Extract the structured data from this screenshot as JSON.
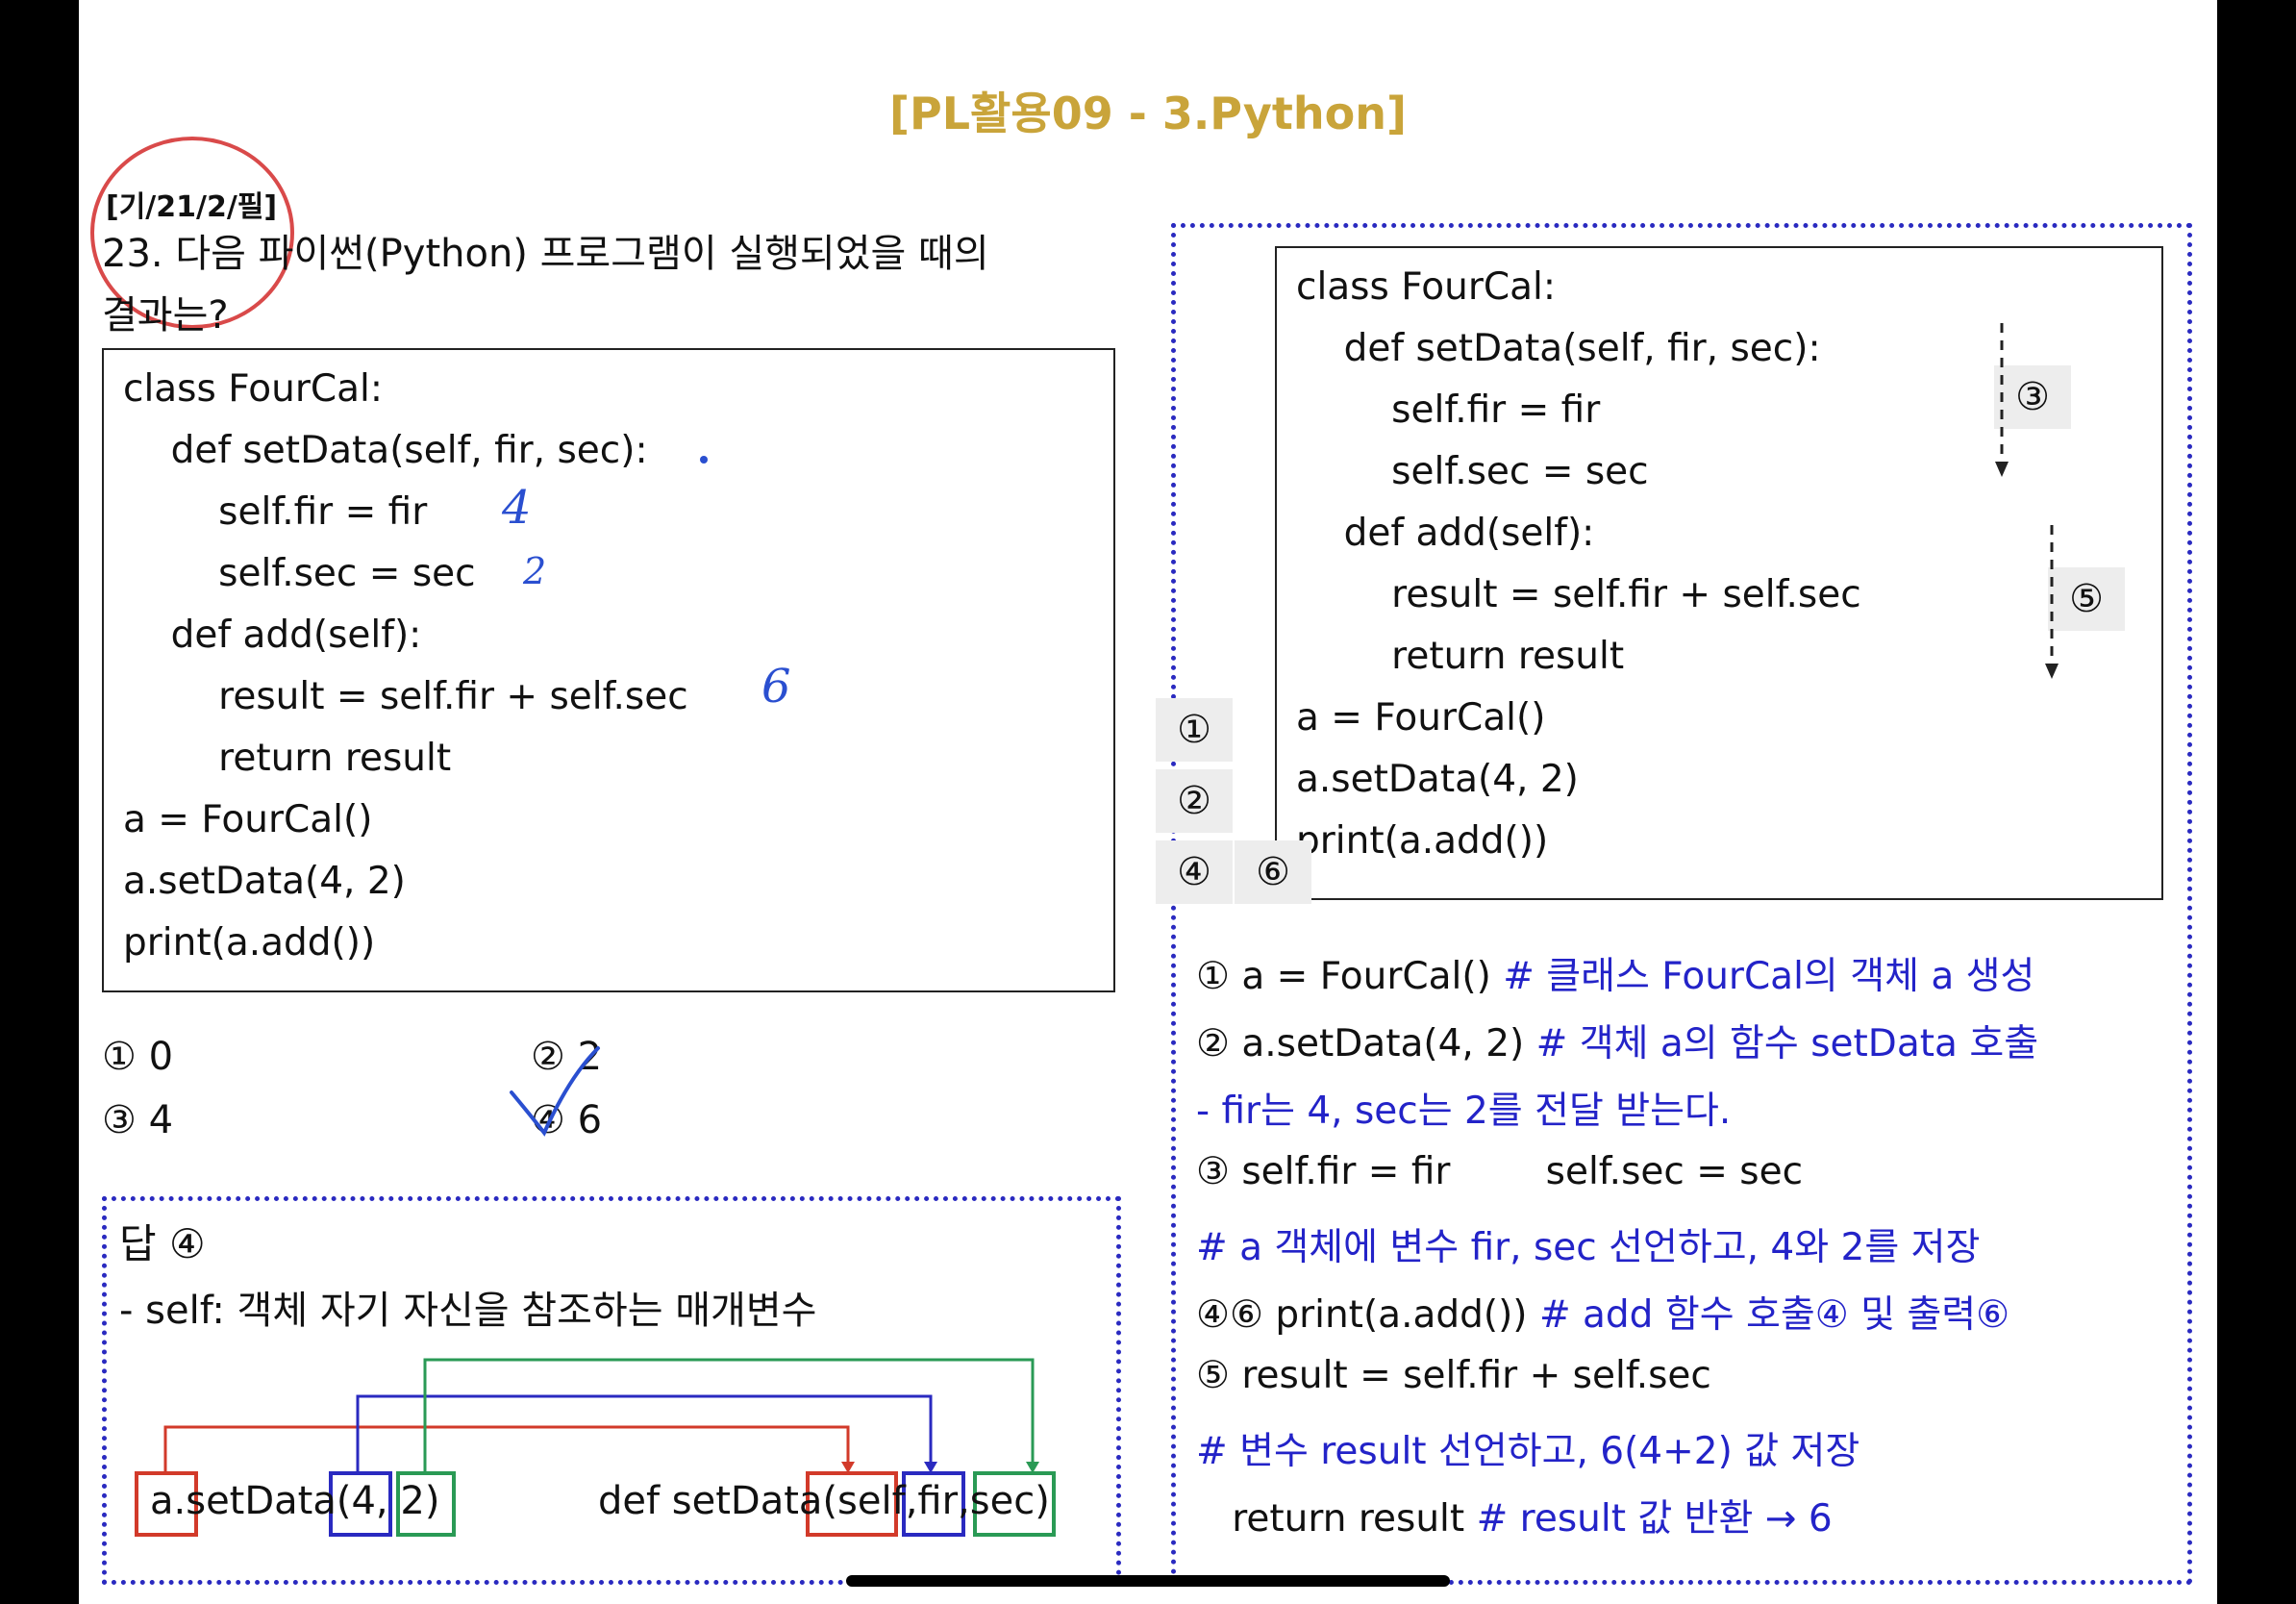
{
  "title": "[PL활용09 - 3.Python]",
  "question": {
    "tag": "[기/21/2/필]",
    "text_line1": "23. 다음 파이썬(Python) 프로그램이 실행되었을 때의",
    "text_line2": "결과는?",
    "code": [
      "class FourCal:",
      "    def setData(self, fir, sec):",
      "        self.fir = fir",
      "        self.sec = sec",
      "    def add(self):",
      "        result = self.fir + self.sec",
      "        return result",
      "a = FourCal()",
      "a.setData(4, 2)",
      "print(a.add())"
    ],
    "handwritten": {
      "fir": "4",
      "sec": "2",
      "result": "6"
    },
    "options": [
      {
        "num": "①",
        "text": "0"
      },
      {
        "num": "②",
        "text": "2"
      },
      {
        "num": "③",
        "text": "4"
      },
      {
        "num": "④",
        "text": "6"
      }
    ]
  },
  "answer": {
    "title": "답 ④",
    "desc": "- self: 객체 자기 자신을 참조하는 매개변수",
    "diagram": {
      "call": [
        "a.",
        "setData",
        "(4,",
        " 2)"
      ],
      "def": [
        "def setData",
        "(self,",
        "fir,",
        "sec)"
      ]
    }
  },
  "explanation": {
    "code": [
      "class FourCal:",
      "    def setData(self, fir, sec):",
      "        self.fir = fir",
      "        self.sec = sec",
      "    def add(self):",
      "        result = self.fir + self.sec",
      "        return result",
      "a = FourCal()",
      "a.setData(4, 2)",
      "print(a.add())"
    ],
    "markers": [
      "①",
      "②",
      "④",
      "⑥",
      "③",
      "⑤"
    ],
    "lines": [
      {
        "black": "① a = FourCal() ",
        "blue": "# 클래스 FourCal의 객체 a 생성"
      },
      {
        "black": "② a.setData(4, 2) ",
        "blue": "# 객체 a의 함수 setData 호출"
      },
      {
        "black": "",
        "blue": "- fir는 4, sec는 2를 전달 받는다."
      },
      {
        "black": "③ self.fir = fir        self.sec = sec",
        "blue": ""
      },
      {
        "black": "",
        "blue": "# a 객체에 변수 fir, sec 선언하고, 4와 2를 저장"
      },
      {
        "black": "④⑥ print(a.add()) ",
        "blue": "# add 함수 호출④ 및 출력⑥"
      },
      {
        "black": "⑤ result = self.fir + self.sec",
        "blue": ""
      },
      {
        "black": "",
        "blue": "# 변수 result 선언하고, 6(4+2) 값 저장"
      },
      {
        "black": "   return result ",
        "blue": "# result 값 반환 → 6"
      }
    ]
  },
  "colors": {
    "title": "#c9a43a",
    "blue_text": "#2323c8",
    "red": "#d23a2a",
    "blue": "#2a2ac0",
    "green": "#2a9a55"
  }
}
